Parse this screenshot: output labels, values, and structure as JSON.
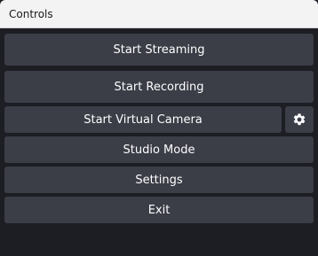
{
  "window": {
    "title": "Controls"
  },
  "controls": {
    "start_streaming": "Start Streaming",
    "start_recording": "Start Recording",
    "start_virtual_camera": "Start Virtual Camera",
    "virtual_camera_settings_icon": "gear-icon",
    "studio_mode": "Studio Mode",
    "settings": "Settings",
    "exit": "Exit"
  },
  "colors": {
    "background": "#1d1e24",
    "button": "#3b3d47",
    "titlebar": "#f3f3f3",
    "text": "#ffffff"
  }
}
